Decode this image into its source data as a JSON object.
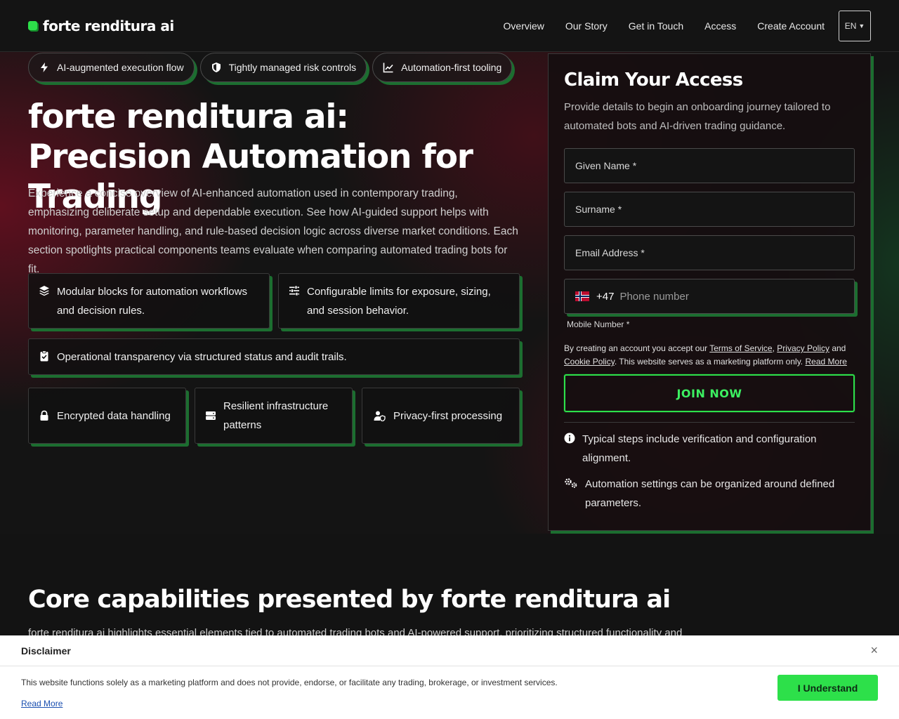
{
  "header": {
    "brand": "forte renditura ai",
    "nav": [
      "Overview",
      "Our Story",
      "Get in Touch",
      "Access",
      "Create Account"
    ],
    "lang": "EN"
  },
  "hero": {
    "pills": [
      "AI-augmented execution flow",
      "Tightly managed risk controls",
      "Automation-first tooling"
    ],
    "title": "forte renditura ai: Precision Automation for Trading",
    "lead": "Experience a concise overview of AI-enhanced automation used in contemporary trading, emphasizing deliberate setup and dependable execution. See how AI-guided support helps with monitoring, parameter handling, and rule-based decision logic across diverse market conditions. Each section spotlights practical components teams evaluate when comparing automated trading bots for fit.",
    "cards": [
      "Modular blocks for automation workflows and decision rules.",
      "Configurable limits for exposure, sizing, and session behavior.",
      "Operational transparency via structured status and audit trails."
    ],
    "small_cards": [
      "Encrypted data handling",
      "Resilient infrastructure patterns",
      "Privacy-first processing"
    ]
  },
  "form": {
    "title": "Claim Your Access",
    "subtitle": "Provide details to begin an onboarding journey tailored to automated bots and AI-driven trading guidance.",
    "given_name": "Given Name *",
    "surname": "Surname *",
    "email": "Email Address *",
    "dial_code": "+47",
    "phone_placeholder": "Phone number",
    "phone_label": "Mobile Number *",
    "terms_prefix": "By creating an account you accept our",
    "terms_link": "Terms of Service",
    "privacy_link": "Privacy Policy",
    "and": "and",
    "cookie_link": "Cookie Policy",
    "terms_suffix": ". This website serves as a marketing platform only.",
    "read_more": "Read More",
    "join": "JOIN NOW",
    "notes": [
      "Typical steps include verification and configuration alignment.",
      "Automation settings can be organized around defined parameters."
    ]
  },
  "section": {
    "title": "Core capabilities presented by forte renditura ai",
    "text": "forte renditura ai highlights essential elements tied to automated trading bots and AI-powered support, prioritizing structured functionality and"
  },
  "disclaimer": {
    "title": "Disclaimer",
    "text": "This website functions solely as a marketing platform and does not provide, endorse, or facilitate any trading, brokerage, or investment services.",
    "read_more": "Read More",
    "button": "I Understand",
    "close": "×"
  },
  "colors": {
    "accent": "#2de04a",
    "accent_dark": "#1c6e30",
    "bg": "#141414",
    "hero_red": "#780e22"
  }
}
